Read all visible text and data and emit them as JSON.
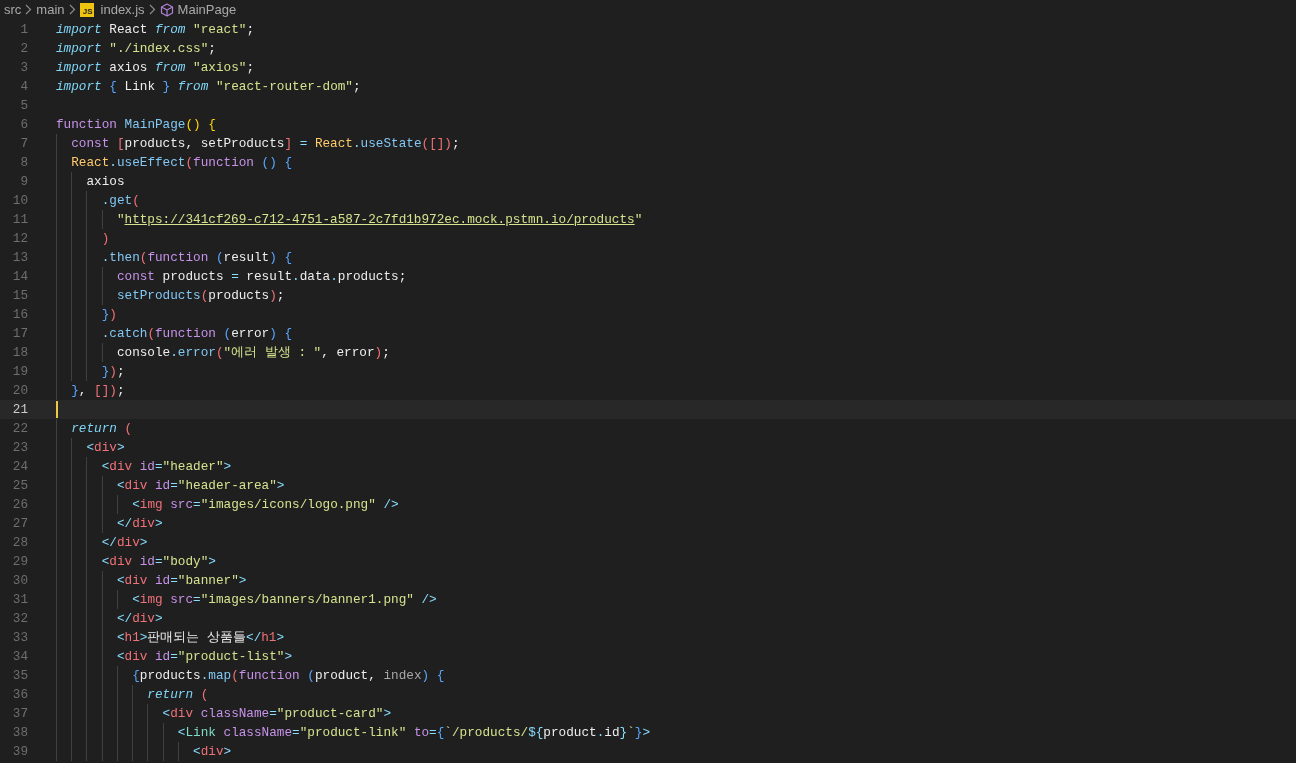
{
  "breadcrumbs": [
    {
      "kind": "folder",
      "label": "src"
    },
    {
      "kind": "folder",
      "label": "main"
    },
    {
      "kind": "file",
      "badge": "JS",
      "label": "index.js"
    },
    {
      "kind": "symbol",
      "label": "MainPage"
    }
  ],
  "editor": {
    "lines": [
      {
        "number": "1",
        "current": false,
        "tokens": [
          {
            "kind": "kw",
            "text": "import"
          },
          {
            "kind": "p",
            "text": " React "
          },
          {
            "kind": "kw",
            "text": "from"
          },
          {
            "kind": "str",
            "text": " \"react\""
          },
          {
            "kind": "p",
            "text": ";"
          }
        ]
      },
      {
        "number": "2",
        "current": false,
        "tokens": [
          {
            "kind": "kw",
            "text": "import"
          },
          {
            "kind": "str",
            "text": " \"./index.css\""
          },
          {
            "kind": "p",
            "text": ";"
          }
        ]
      },
      {
        "number": "3",
        "current": false,
        "tokens": [
          {
            "kind": "kw",
            "text": "import"
          },
          {
            "kind": "p",
            "text": " axios "
          },
          {
            "kind": "kw",
            "text": "from"
          },
          {
            "kind": "str",
            "text": " \"axios\""
          },
          {
            "kind": "p",
            "text": ";"
          }
        ]
      },
      {
        "number": "4",
        "current": false,
        "tokens": [
          {
            "kind": "kw",
            "text": "import"
          },
          {
            "kind": "b3",
            "text": " {"
          },
          {
            "kind": "p",
            "text": " Link "
          },
          {
            "kind": "b3",
            "text": "}"
          },
          {
            "kind": "kw",
            "text": " from"
          },
          {
            "kind": "str",
            "text": " \"react-router-dom\""
          },
          {
            "kind": "p",
            "text": ";"
          }
        ]
      },
      {
        "number": "5",
        "current": false
      },
      {
        "number": "6",
        "current": false,
        "tokens": [
          {
            "kind": "st",
            "text": "function"
          },
          {
            "kind": "fn",
            "text": " MainPage"
          },
          {
            "kind": "b1",
            "text": "()"
          },
          {
            "kind": "b1",
            "text": " {"
          }
        ]
      },
      {
        "number": "7",
        "current": false,
        "tokens": [
          {
            "kind": "st",
            "text": "  const"
          },
          {
            "kind": "b2",
            "text": " ["
          },
          {
            "kind": "p",
            "text": "products, setProducts"
          },
          {
            "kind": "b2",
            "text": "]"
          },
          {
            "kind": "pu",
            "text": " = "
          },
          {
            "kind": "cls",
            "text": "React"
          },
          {
            "kind": "pu",
            "text": "."
          },
          {
            "kind": "fn",
            "text": "useState"
          },
          {
            "kind": "b2",
            "text": "([])"
          },
          {
            "kind": "p",
            "text": ";"
          }
        ]
      },
      {
        "number": "8",
        "current": false,
        "tokens": [
          {
            "kind": "cls",
            "text": "  React"
          },
          {
            "kind": "pu",
            "text": "."
          },
          {
            "kind": "fn",
            "text": "useEffect"
          },
          {
            "kind": "b2",
            "text": "("
          },
          {
            "kind": "st",
            "text": "function"
          },
          {
            "kind": "b3",
            "text": " ()"
          },
          {
            "kind": "b3",
            "text": " {"
          }
        ]
      },
      {
        "number": "9",
        "current": false,
        "tokens": [
          {
            "kind": "p",
            "text": "    axios"
          }
        ]
      },
      {
        "number": "10",
        "current": false,
        "tokens": [
          {
            "kind": "pu",
            "text": "      ."
          },
          {
            "kind": "fn",
            "text": "get"
          },
          {
            "kind": "b2",
            "text": "("
          }
        ]
      },
      {
        "number": "11",
        "current": false,
        "tokens": [
          {
            "kind": "str",
            "text": "        \""
          },
          {
            "kind": "url",
            "text": "https://341cf269-c712-4751-a587-2c7fd1b972ec.mock.pstmn.io/products"
          },
          {
            "kind": "str",
            "text": "\""
          }
        ]
      },
      {
        "number": "12",
        "current": false,
        "tokens": [
          {
            "kind": "b2",
            "text": "      )"
          }
        ]
      },
      {
        "number": "13",
        "current": false,
        "tokens": [
          {
            "kind": "pu",
            "text": "      ."
          },
          {
            "kind": "fn",
            "text": "then"
          },
          {
            "kind": "b2",
            "text": "("
          },
          {
            "kind": "st",
            "text": "function"
          },
          {
            "kind": "b3",
            "text": " ("
          },
          {
            "kind": "p",
            "text": "result"
          },
          {
            "kind": "b3",
            "text": ")"
          },
          {
            "kind": "b3",
            "text": " {"
          }
        ]
      },
      {
        "number": "14",
        "current": false,
        "tokens": [
          {
            "kind": "st",
            "text": "        const"
          },
          {
            "kind": "p",
            "text": " products "
          },
          {
            "kind": "pu",
            "text": "="
          },
          {
            "kind": "p",
            "text": " result"
          },
          {
            "kind": "pu",
            "text": "."
          },
          {
            "kind": "p",
            "text": "data"
          },
          {
            "kind": "pu",
            "text": "."
          },
          {
            "kind": "p",
            "text": "products;"
          }
        ]
      },
      {
        "number": "15",
        "current": false,
        "tokens": [
          {
            "kind": "fn",
            "text": "        setProducts"
          },
          {
            "kind": "b2",
            "text": "("
          },
          {
            "kind": "p",
            "text": "products"
          },
          {
            "kind": "b2",
            "text": ")"
          },
          {
            "kind": "p",
            "text": ";"
          }
        ]
      },
      {
        "number": "16",
        "current": false,
        "tokens": [
          {
            "kind": "b3",
            "text": "      }"
          },
          {
            "kind": "b2",
            "text": ")"
          }
        ]
      },
      {
        "number": "17",
        "current": false,
        "tokens": [
          {
            "kind": "pu",
            "text": "      ."
          },
          {
            "kind": "fn",
            "text": "catch"
          },
          {
            "kind": "b2",
            "text": "("
          },
          {
            "kind": "st",
            "text": "function"
          },
          {
            "kind": "b3",
            "text": " ("
          },
          {
            "kind": "p",
            "text": "error"
          },
          {
            "kind": "b3",
            "text": ")"
          },
          {
            "kind": "b3",
            "text": " {"
          }
        ]
      },
      {
        "number": "18",
        "current": false,
        "tokens": [
          {
            "kind": "p",
            "text": "        console"
          },
          {
            "kind": "pu",
            "text": "."
          },
          {
            "kind": "fn",
            "text": "error"
          },
          {
            "kind": "b2",
            "text": "("
          },
          {
            "kind": "str",
            "text": "\"에러 발생 : \""
          },
          {
            "kind": "p",
            "text": ", error"
          },
          {
            "kind": "b2",
            "text": ")"
          },
          {
            "kind": "p",
            "text": ";"
          }
        ]
      },
      {
        "number": "19",
        "current": false,
        "tokens": [
          {
            "kind": "b3",
            "text": "      }"
          },
          {
            "kind": "b2",
            "text": ")"
          },
          {
            "kind": "p",
            "text": ";"
          }
        ]
      },
      {
        "number": "20",
        "current": false,
        "tokens": [
          {
            "kind": "b3",
            "text": "  }"
          },
          {
            "kind": "p",
            "text": ", "
          },
          {
            "kind": "b2",
            "text": "[])"
          },
          {
            "kind": "p",
            "text": ";"
          }
        ]
      },
      {
        "number": "21",
        "current": true
      },
      {
        "number": "22",
        "current": false,
        "tokens": [
          {
            "kind": "kw",
            "text": "  return"
          },
          {
            "kind": "b2",
            "text": " ("
          }
        ]
      },
      {
        "number": "23",
        "current": false,
        "tokens": [
          {
            "kind": "pu",
            "text": "    <"
          },
          {
            "kind": "tag",
            "text": "div"
          },
          {
            "kind": "pu",
            "text": ">"
          }
        ]
      },
      {
        "number": "24",
        "current": false,
        "tokens": [
          {
            "kind": "pu",
            "text": "      <"
          },
          {
            "kind": "tag",
            "text": "div"
          },
          {
            "kind": "attr",
            "text": " id"
          },
          {
            "kind": "pu",
            "text": "="
          },
          {
            "kind": "str",
            "text": "\"header\""
          },
          {
            "kind": "pu",
            "text": ">"
          }
        ]
      },
      {
        "number": "25",
        "current": false,
        "tokens": [
          {
            "kind": "pu",
            "text": "        <"
          },
          {
            "kind": "tag",
            "text": "div"
          },
          {
            "kind": "attr",
            "text": " id"
          },
          {
            "kind": "pu",
            "text": "="
          },
          {
            "kind": "str",
            "text": "\"header-area\""
          },
          {
            "kind": "pu",
            "text": ">"
          }
        ]
      },
      {
        "number": "26",
        "current": false,
        "tokens": [
          {
            "kind": "pu",
            "text": "          <"
          },
          {
            "kind": "tag",
            "text": "img"
          },
          {
            "kind": "attr",
            "text": " src"
          },
          {
            "kind": "pu",
            "text": "="
          },
          {
            "kind": "str",
            "text": "\"images/icons/logo.png\""
          },
          {
            "kind": "pu",
            "text": " />"
          }
        ]
      },
      {
        "number": "27",
        "current": false,
        "tokens": [
          {
            "kind": "pu",
            "text": "        </"
          },
          {
            "kind": "tag",
            "text": "div"
          },
          {
            "kind": "pu",
            "text": ">"
          }
        ]
      },
      {
        "number": "28",
        "current": false,
        "tokens": [
          {
            "kind": "pu",
            "text": "      </"
          },
          {
            "kind": "tag",
            "text": "div"
          },
          {
            "kind": "pu",
            "text": ">"
          }
        ]
      },
      {
        "number": "29",
        "current": false,
        "tokens": [
          {
            "kind": "pu",
            "text": "      <"
          },
          {
            "kind": "tag",
            "text": "div"
          },
          {
            "kind": "attr",
            "text": " id"
          },
          {
            "kind": "pu",
            "text": "="
          },
          {
            "kind": "str",
            "text": "\"body\""
          },
          {
            "kind": "pu",
            "text": ">"
          }
        ]
      },
      {
        "number": "30",
        "current": false,
        "tokens": [
          {
            "kind": "pu",
            "text": "        <"
          },
          {
            "kind": "tag",
            "text": "div"
          },
          {
            "kind": "attr",
            "text": " id"
          },
          {
            "kind": "pu",
            "text": "="
          },
          {
            "kind": "str",
            "text": "\"banner\""
          },
          {
            "kind": "pu",
            "text": ">"
          }
        ]
      },
      {
        "number": "31",
        "current": false,
        "tokens": [
          {
            "kind": "pu",
            "text": "          <"
          },
          {
            "kind": "tag",
            "text": "img"
          },
          {
            "kind": "attr",
            "text": " src"
          },
          {
            "kind": "pu",
            "text": "="
          },
          {
            "kind": "str",
            "text": "\"images/banners/banner1.png\""
          },
          {
            "kind": "pu",
            "text": " />"
          }
        ]
      },
      {
        "number": "32",
        "current": false,
        "tokens": [
          {
            "kind": "pu",
            "text": "        </"
          },
          {
            "kind": "tag",
            "text": "div"
          },
          {
            "kind": "pu",
            "text": ">"
          }
        ]
      },
      {
        "number": "33",
        "current": false,
        "tokens": [
          {
            "kind": "pu",
            "text": "        <"
          },
          {
            "kind": "tag",
            "text": "h1"
          },
          {
            "kind": "pu",
            "text": ">"
          },
          {
            "kind": "p",
            "text": "판매되는 상품들"
          },
          {
            "kind": "pu",
            "text": "</"
          },
          {
            "kind": "tag",
            "text": "h1"
          },
          {
            "kind": "pu",
            "text": ">"
          }
        ]
      },
      {
        "number": "34",
        "current": false,
        "tokens": [
          {
            "kind": "pu",
            "text": "        <"
          },
          {
            "kind": "tag",
            "text": "div"
          },
          {
            "kind": "attr",
            "text": " id"
          },
          {
            "kind": "pu",
            "text": "="
          },
          {
            "kind": "str",
            "text": "\"product-list\""
          },
          {
            "kind": "pu",
            "text": ">"
          }
        ]
      },
      {
        "number": "35",
        "current": false,
        "tokens": [
          {
            "kind": "b3",
            "text": "          {"
          },
          {
            "kind": "p",
            "text": "products"
          },
          {
            "kind": "pu",
            "text": "."
          },
          {
            "kind": "fn",
            "text": "map"
          },
          {
            "kind": "b2",
            "text": "("
          },
          {
            "kind": "st",
            "text": "function"
          },
          {
            "kind": "b3",
            "text": " ("
          },
          {
            "kind": "p",
            "text": "product, "
          },
          {
            "kind": "dim",
            "text": "index"
          },
          {
            "kind": "b3",
            "text": ")"
          },
          {
            "kind": "b3",
            "text": " {"
          }
        ]
      },
      {
        "number": "36",
        "current": false,
        "tokens": [
          {
            "kind": "kw",
            "text": "            return"
          },
          {
            "kind": "b2",
            "text": " ("
          }
        ]
      },
      {
        "number": "37",
        "current": false,
        "tokens": [
          {
            "kind": "pu",
            "text": "              <"
          },
          {
            "kind": "tag",
            "text": "div"
          },
          {
            "kind": "attr",
            "text": " className"
          },
          {
            "kind": "pu",
            "text": "="
          },
          {
            "kind": "str",
            "text": "\"product-card\""
          },
          {
            "kind": "pu",
            "text": ">"
          }
        ]
      },
      {
        "number": "38",
        "current": false,
        "tokens": [
          {
            "kind": "pu",
            "text": "                <"
          },
          {
            "kind": "comp",
            "text": "Link"
          },
          {
            "kind": "attr",
            "text": " className"
          },
          {
            "kind": "pu",
            "text": "="
          },
          {
            "kind": "str",
            "text": "\"product-link\""
          },
          {
            "kind": "attr",
            "text": " to"
          },
          {
            "kind": "pu",
            "text": "="
          },
          {
            "kind": "b3",
            "text": "{"
          },
          {
            "kind": "str",
            "text": "`/products/"
          },
          {
            "kind": "pu",
            "text": "${"
          },
          {
            "kind": "p",
            "text": "product"
          },
          {
            "kind": "pu",
            "text": "."
          },
          {
            "kind": "p",
            "text": "id"
          },
          {
            "kind": "pu",
            "text": "}"
          },
          {
            "kind": "str",
            "text": "`"
          },
          {
            "kind": "b3",
            "text": "}"
          },
          {
            "kind": "pu",
            "text": ">"
          }
        ]
      },
      {
        "number": "39",
        "current": false,
        "tokens": [
          {
            "kind": "pu",
            "text": "                  <"
          },
          {
            "kind": "tag",
            "text": "div"
          },
          {
            "kind": "pu",
            "text": ">"
          }
        ]
      }
    ]
  }
}
